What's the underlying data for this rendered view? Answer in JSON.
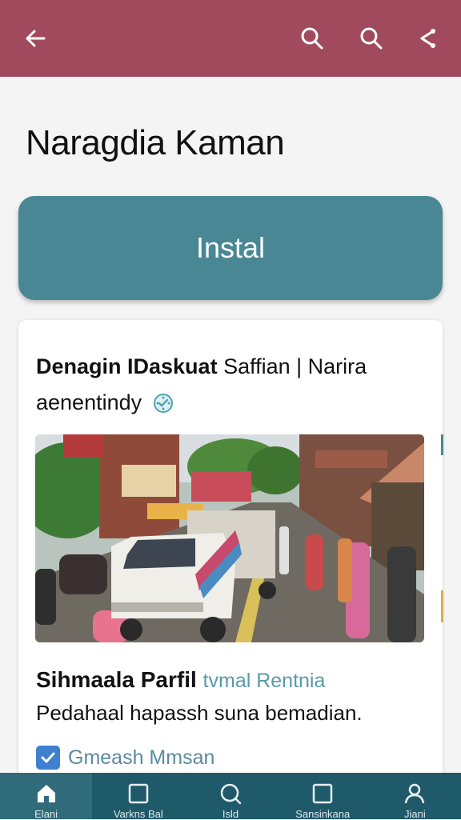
{
  "topbar": {
    "icons": [
      "back-arrow-icon",
      "search-icon",
      "search-icon",
      "share-icon"
    ],
    "color": "#a14a5e"
  },
  "app": {
    "title": "Naragdia Kaman"
  },
  "install": {
    "label": "Instal",
    "color": "#4a8795"
  },
  "card": {
    "heading_bold": "Denagin IDaskuat",
    "heading_rest": " Saffian | Narira",
    "heading_line2": "aenentindy",
    "subtitle_bold": "Sihmaala Parfil",
    "subtitle_accent": "tvmal Rentnia",
    "description": "Pedahaal hapassh suna bemadian.",
    "checkbox": {
      "checked": true,
      "label": "Gmeash Mmsan"
    }
  },
  "bottom_nav": {
    "items": [
      {
        "label": "Elani",
        "icon": "home-icon",
        "active": true
      },
      {
        "label": "Varkns Bal",
        "icon": "square-icon",
        "active": false
      },
      {
        "label": "Isld",
        "icon": "search-icon",
        "active": false
      },
      {
        "label": "Sansinkana",
        "icon": "square-icon",
        "active": false
      },
      {
        "label": "Jiani",
        "icon": "profile-icon",
        "active": false
      }
    ],
    "color": "#1f5a6a"
  }
}
